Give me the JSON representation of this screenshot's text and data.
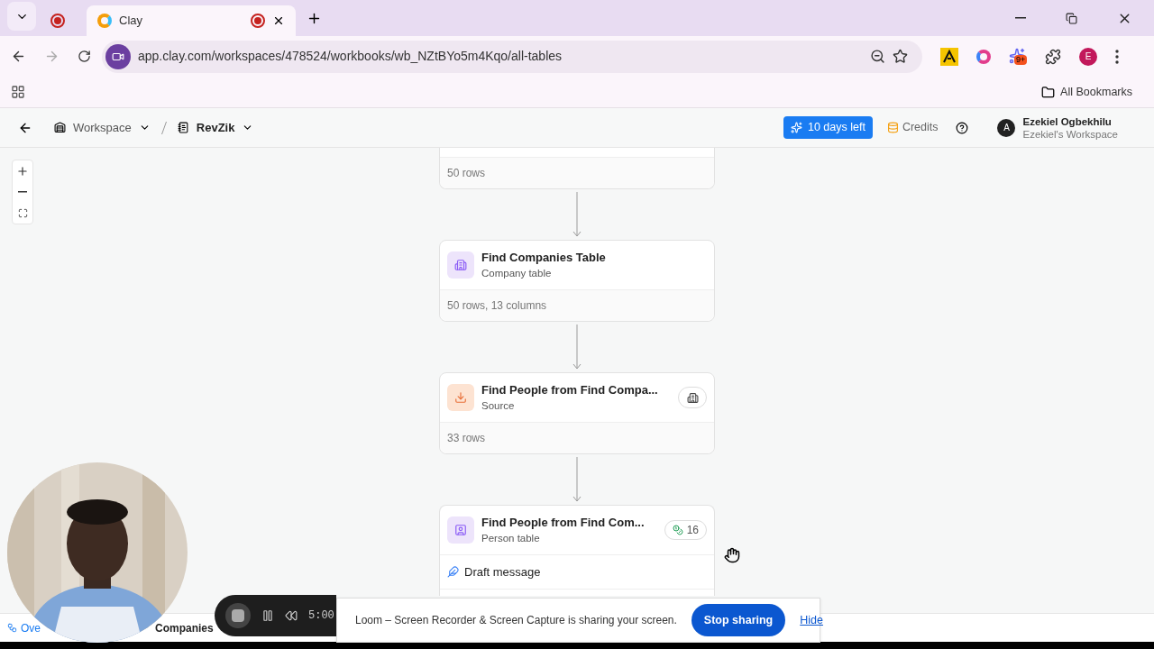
{
  "browser": {
    "tabs": [
      {
        "recording": true,
        "selected": false
      },
      {
        "title": "Clay",
        "recording": true,
        "selected": true
      }
    ],
    "url": "app.clay.com/workspaces/478524/workbooks/wb_NZtBYo5m4Kqo/all-tables",
    "extension_badge": "9+",
    "profile": "E",
    "bookmarks": [
      "All Bookmarks"
    ]
  },
  "header": {
    "breadcrumb": [
      {
        "label": "Workspace",
        "kind": "workspace"
      },
      {
        "label": "RevZik",
        "kind": "workbook"
      }
    ],
    "trial": "10 days left",
    "credits": "Credits",
    "user": {
      "name": "Ezekiel Ogbekhilu",
      "workspace": "Ezekiel's Workspace",
      "initial": "A"
    }
  },
  "nodes": [
    {
      "kind": "cut",
      "footer": "50 rows"
    },
    {
      "kind": "company",
      "title": "Find Companies Table",
      "subtitle": "Company table",
      "footer": "50 rows, 13 columns"
    },
    {
      "kind": "source",
      "title": "Find People from Find Compa...",
      "subtitle": "Source",
      "footer": "33 rows",
      "badge": {
        "kind": "building"
      }
    },
    {
      "kind": "person",
      "title": "Find People from Find Com...",
      "subtitle": "Person table",
      "badge": {
        "kind": "credits",
        "count": "16"
      },
      "action": "Draft message"
    }
  ],
  "bottom_tabs": [
    {
      "label": "Ove",
      "selected": true
    },
    {
      "label": "Companies",
      "selected": false
    }
  ],
  "recorder": {
    "timer": "5:00"
  },
  "share_bar": {
    "message": "Loom – Screen Recorder & Screen Capture is sharing your screen.",
    "stop": "Stop sharing",
    "hide": "Hide"
  }
}
